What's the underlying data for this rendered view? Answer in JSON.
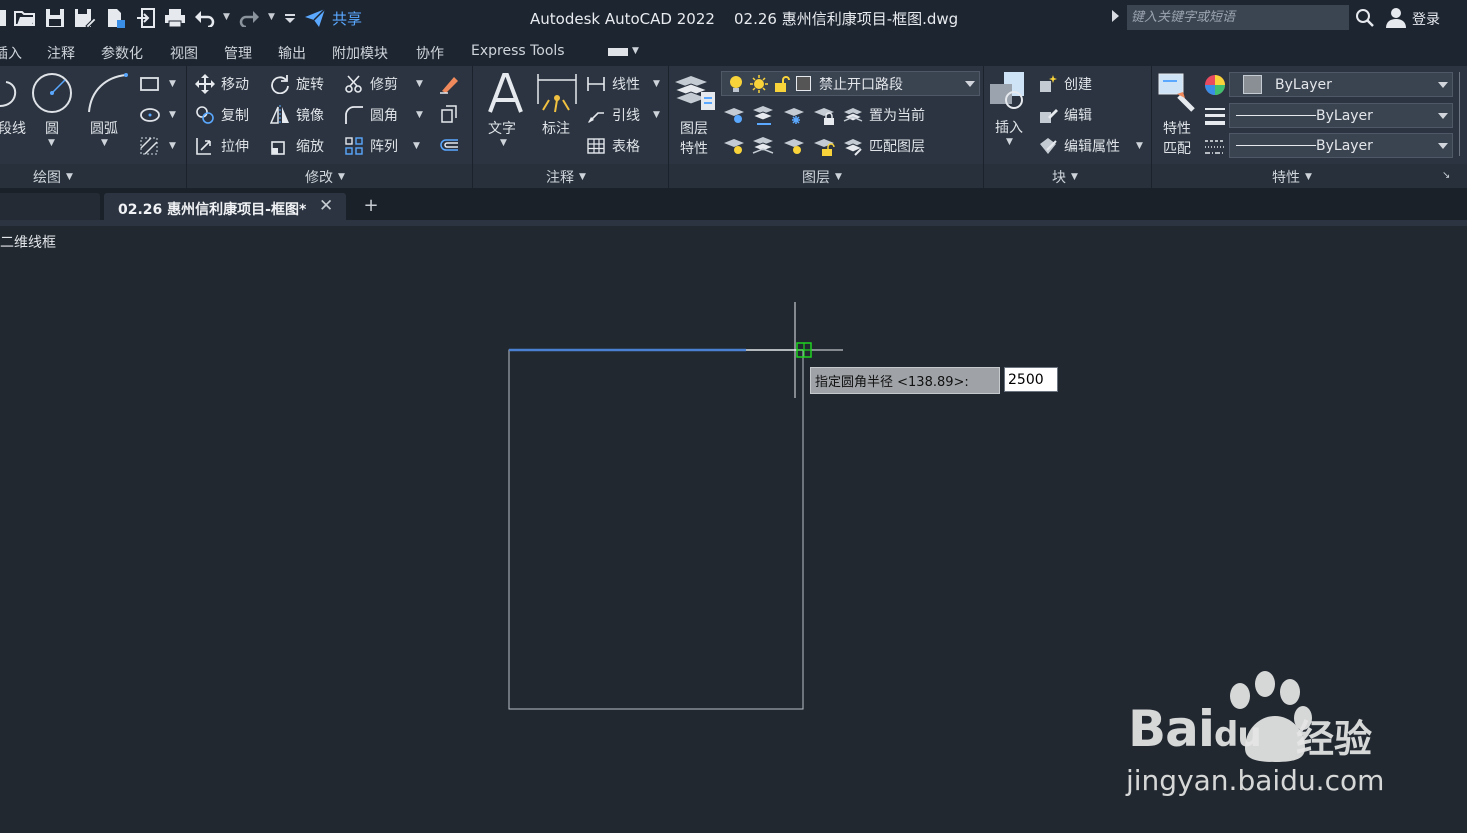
{
  "titlebar": {
    "share_label": "共享",
    "app_title": "Autodesk AutoCAD 2022",
    "file_title": "02.26 惠州信利康项目-框图.dwg",
    "search_placeholder": "键入关键字或短语",
    "login_label": "登录"
  },
  "menu": {
    "items": [
      "插入",
      "注释",
      "参数化",
      "视图",
      "管理",
      "输出",
      "附加模块",
      "协作",
      "Express Tools"
    ]
  },
  "ribbon": {
    "draw": {
      "title": "绘图",
      "polyline_label": "段线",
      "circle_label": "圆",
      "arc_label": "圆弧"
    },
    "modify": {
      "title": "修改",
      "move": "移动",
      "rotate": "旋转",
      "trim": "修剪",
      "copy": "复制",
      "mirror": "镜像",
      "fillet": "圆角",
      "stretch": "拉伸",
      "scale": "缩放",
      "array": "阵列"
    },
    "annotation": {
      "title": "注释",
      "text": "文字",
      "dimension": "标注",
      "linear": "线性",
      "leader": "引线",
      "table": "表格"
    },
    "layers": {
      "title": "图层",
      "properties_l1": "图层",
      "properties_l2": "特性",
      "current_layer": "禁止开口路段",
      "make_current": "置为当前",
      "match_layer": "匹配图层"
    },
    "block": {
      "title": "块",
      "insert": "插入",
      "create": "创建",
      "edit": "编辑",
      "edit_attributes": "编辑属性"
    },
    "properties": {
      "title": "特性",
      "match_l1": "特性",
      "match_l2": "匹配",
      "color": "ByLayer",
      "linetype": "ByLayer",
      "lineweight": "ByLayer"
    }
  },
  "file_tab": {
    "label": "02.26 惠州信利康项目-框图*",
    "close": "✕",
    "new_tab": "+"
  },
  "viewport": {
    "label": "二维线框"
  },
  "prompt": {
    "text": "指定圆角半径 <138.89>:",
    "value": "2500"
  },
  "watermark": {
    "brand": "Bai",
    "brand_tail": "du",
    "suffix": "经验",
    "url": "jingyan.baidu.com"
  },
  "colors": {
    "background": "#212830",
    "ribbon": "#2b3440",
    "accent_blue": "#5aa8ff",
    "osnap_green": "#1fd31f"
  }
}
